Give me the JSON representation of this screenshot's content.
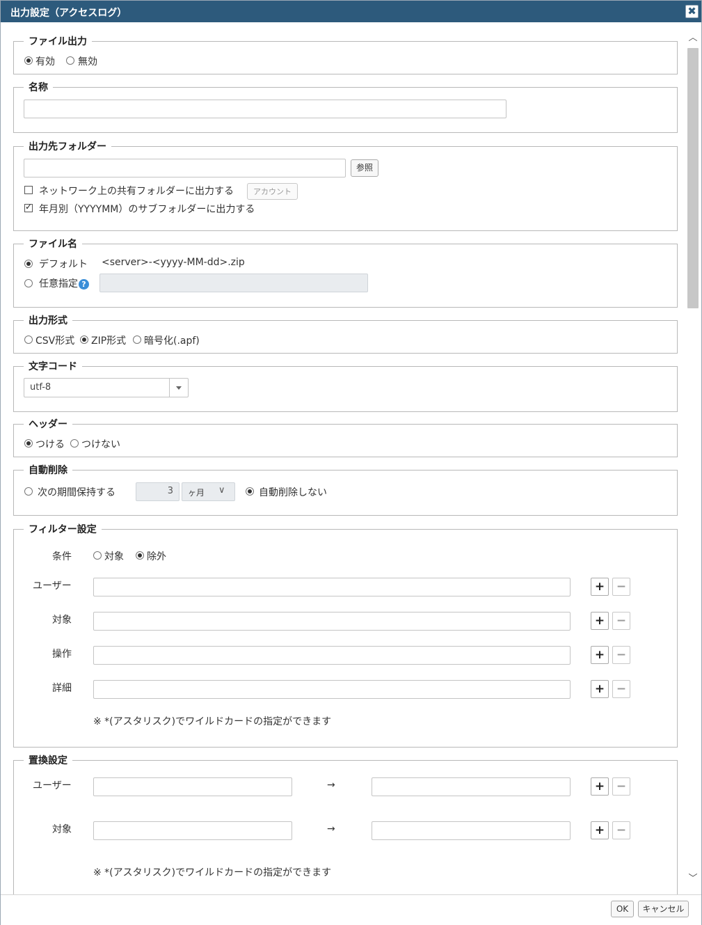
{
  "dialog": {
    "title": "出力設定（アクセスログ）",
    "close_glyph": "✖"
  },
  "sections": {
    "file_output": {
      "legend": "ファイル出力",
      "enabled_label": "有効",
      "disabled_label": "無効",
      "selected": "enabled"
    },
    "name": {
      "legend": "名称",
      "value": ""
    },
    "folder": {
      "legend": "出力先フォルダー",
      "value": "",
      "browse_label": "参照",
      "network_label": "ネットワーク上の共有フォルダーに出力する",
      "network_checked": false,
      "account_label": "アカウント",
      "subfolder_label": "年月別（YYYYMM）のサブフォルダーに出力する",
      "subfolder_checked": true
    },
    "filename": {
      "legend": "ファイル名",
      "default_label": "デフォルト",
      "default_pattern": "<server>-<yyyy-MM-dd>.zip",
      "custom_label": "任意指定",
      "help_glyph": "?",
      "selected": "default"
    },
    "format": {
      "legend": "出力形式",
      "csv_label": "CSV形式",
      "zip_label": "ZIP形式",
      "enc_label": "暗号化(.apf)",
      "selected": "zip"
    },
    "charset": {
      "legend": "文字コード",
      "value": "utf-8"
    },
    "header": {
      "legend": "ヘッダー",
      "on_label": "つける",
      "off_label": "つけない",
      "selected": "on"
    },
    "auto_delete": {
      "legend": "自動削除",
      "keep_label": "次の期間保持する",
      "period_value": "3",
      "period_unit": "ヶ月",
      "none_label": "自動削除しない",
      "selected": "none"
    },
    "filter": {
      "legend": "フィルター設定",
      "condition_label": "条件",
      "target_label": "対象",
      "exclude_label": "除外",
      "selected": "exclude",
      "rows": [
        {
          "label": "ユーザー"
        },
        {
          "label": "対象"
        },
        {
          "label": "操作"
        },
        {
          "label": "詳細"
        }
      ],
      "note": "※ *(アスタリスク)でワイルドカードの指定ができます"
    },
    "replace": {
      "legend": "置換設定",
      "rows": [
        {
          "label": "ユーザー",
          "arrow": "→"
        },
        {
          "label": "対象",
          "arrow": "→"
        }
      ],
      "note": "※ *(アスタリスク)でワイルドカードの指定ができます"
    }
  },
  "icons": {
    "plus": "+",
    "minus": "−",
    "scroll_up": "︿",
    "scroll_down": "﹀"
  },
  "footer": {
    "ok_label": "OK",
    "cancel_label": "キャンセル"
  }
}
